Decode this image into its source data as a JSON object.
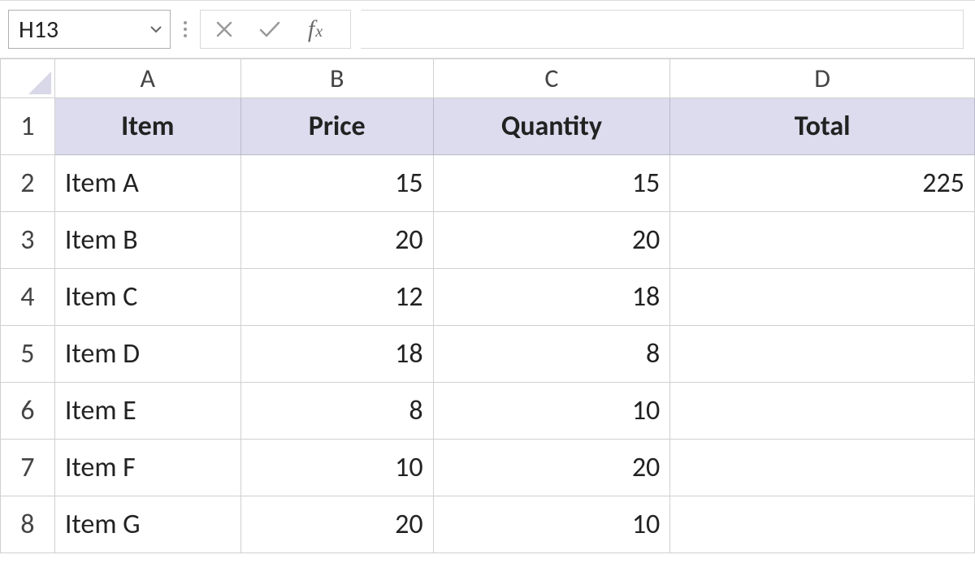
{
  "formula_bar": {
    "cell_reference": "H13",
    "formula": ""
  },
  "sheet": {
    "column_headers": [
      "A",
      "B",
      "C",
      "D"
    ],
    "row_headers": [
      "1",
      "2",
      "3",
      "4",
      "5",
      "6",
      "7",
      "8"
    ],
    "table": {
      "headers": [
        "Item",
        "Price",
        "Quantity",
        "Total"
      ],
      "rows": [
        {
          "item": "Item A",
          "price": "15",
          "quantity": "15",
          "total": "225"
        },
        {
          "item": "Item B",
          "price": "20",
          "quantity": "20",
          "total": ""
        },
        {
          "item": "Item C",
          "price": "12",
          "quantity": "18",
          "total": ""
        },
        {
          "item": "Item D",
          "price": "18",
          "quantity": "8",
          "total": ""
        },
        {
          "item": "Item E",
          "price": "8",
          "quantity": "10",
          "total": ""
        },
        {
          "item": "Item F",
          "price": "10",
          "quantity": "20",
          "total": ""
        },
        {
          "item": "Item G",
          "price": "20",
          "quantity": "10",
          "total": ""
        }
      ]
    }
  }
}
